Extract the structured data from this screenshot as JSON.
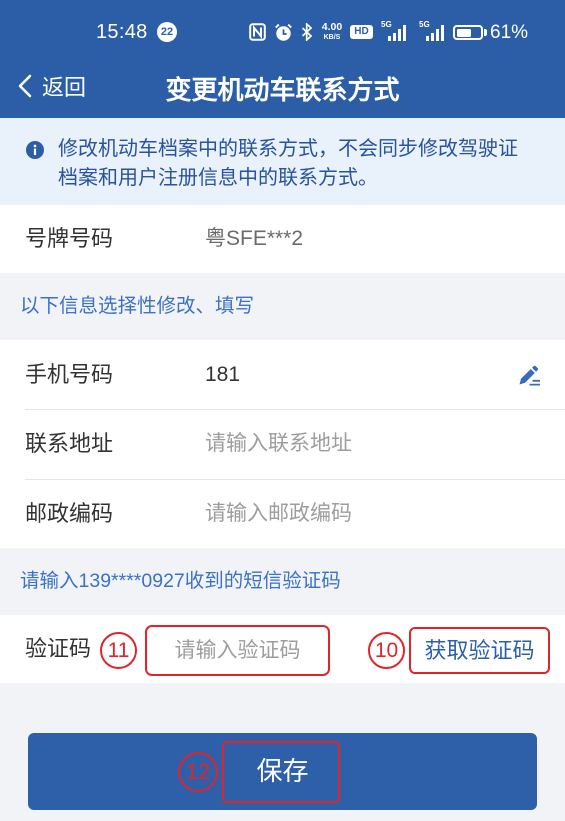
{
  "status_bar": {
    "time": "15:48",
    "notification_count": "22",
    "net_speed": "4.00",
    "net_speed_unit": "KB/S",
    "hd_label": "HD",
    "sim1_network": "5G",
    "sim2_network": "5G",
    "battery_percent_text": "61%",
    "battery_level": 0.61,
    "icons": [
      "nfc-icon",
      "alarm-icon",
      "bluetooth-icon",
      "signal-icon",
      "battery-icon"
    ]
  },
  "nav": {
    "back_label": "返回",
    "title": "变更机动车联系方式",
    "back_icon": "chevron-left-icon"
  },
  "notice": {
    "icon": "info-icon",
    "text": "修改机动车档案中的联系方式，不会同步修改驾驶证档案和用户注册信息中的联系方式。"
  },
  "plate": {
    "label": "号牌号码",
    "value": "粤SFE***2"
  },
  "optional_header": "以下信息选择性修改、填写",
  "fields": {
    "phone": {
      "label": "手机号码",
      "value": "181",
      "icon": "edit-icon"
    },
    "address": {
      "label": "联系地址",
      "placeholder": "请输入联系地址"
    },
    "postcode": {
      "label": "邮政编码",
      "placeholder": "请输入邮政编码"
    }
  },
  "sms_header": "请输入139****0927收到的短信验证码",
  "verification": {
    "label": "验证码",
    "placeholder": "请输入验证码",
    "get_code_label": "获取验证码"
  },
  "save_label": "保存",
  "annotations": {
    "code_input_marker": "11",
    "get_code_marker": "10",
    "save_marker": "12"
  },
  "colors": {
    "primary": "#2b5ea7",
    "button": "#2e5fa9",
    "annotation_red": "#e0242a",
    "notice_background": "#e9f1fb",
    "notice_text": "#29539c",
    "section_text": "#3b72c5",
    "page_background": "#f2f3f7",
    "link_text": "#2a5eb0",
    "icon_blue": "#3a6bbb"
  }
}
